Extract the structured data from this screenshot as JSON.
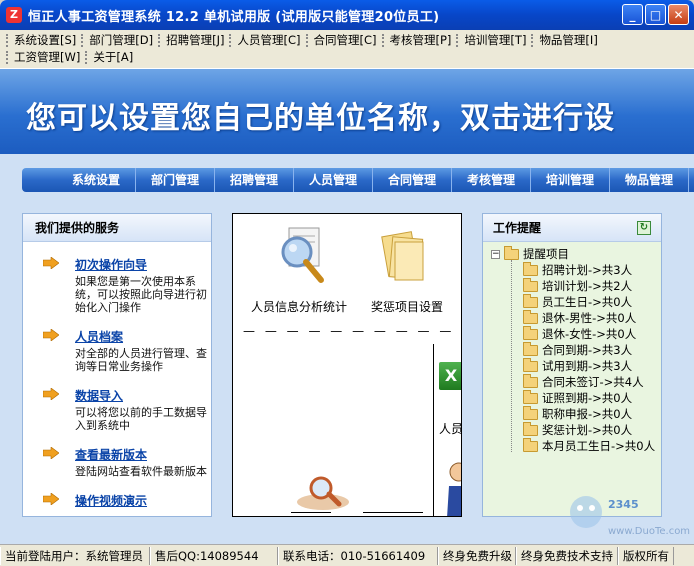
{
  "window": {
    "title": "恒正人事工资管理系统 12.2 单机试用版 (试用版只能管理20位员工)"
  },
  "menu": {
    "row1": [
      "系统设置[S]",
      "部门管理[D]",
      "招聘管理[J]",
      "人员管理[C]",
      "合同管理[C]",
      "考核管理[P]",
      "培训管理[T]",
      "物品管理[I]"
    ],
    "row2": [
      "工资管理[W]",
      "关于[A]"
    ]
  },
  "banner": {
    "text": "您可以设置您自己的单位名称，双击进行设"
  },
  "nav": [
    "系统设置",
    "部门管理",
    "招聘管理",
    "人员管理",
    "合同管理",
    "考核管理",
    "培训管理",
    "物品管理"
  ],
  "services": {
    "title": "我们提供的服务",
    "items": [
      {
        "title": "初次操作向导",
        "desc": "如果您是第一次使用本系统，可以按照此向导进行初始化入门操作"
      },
      {
        "title": "人员档案",
        "desc": "对全部的人员进行管理、查询等日常业务操作"
      },
      {
        "title": "数据导入",
        "desc": "可以将您以前的手工数据导入到系统中"
      },
      {
        "title": "查看最新版本",
        "desc": "登陆网站查看软件最新版本"
      },
      {
        "title": "操作视频演示",
        "desc": ""
      }
    ]
  },
  "center": {
    "item1": "人员信息分析统计",
    "item2": "奖惩项目设置",
    "item3_partial": "人员",
    "dashes": "— — — — — — — — — —"
  },
  "reminders": {
    "title": "工作提醒",
    "root": "提醒项目",
    "items": [
      "招聘计划->共3人",
      "培训计划->共2人",
      "员工生日->共0人",
      "退休-男性->共0人",
      "退休-女性->共0人",
      "合同到期->共3人",
      "试用到期->共3人",
      "合同未签订->共4人",
      "证照到期->共0人",
      "职称申报->共0人",
      "奖惩计划->共0人",
      "本月员工生日->共0人"
    ]
  },
  "status": {
    "user": "当前登陆用户：系统管理员",
    "qq": "售后QQ:14089544",
    "phone": "联系电话：010-51661409",
    "upgrade": "终身免费升级",
    "support": "终身免费技术支持",
    "copyright": "版权所有"
  },
  "colors": {
    "titlebar": "#0846c8",
    "banner": "#2a6fd0",
    "link": "#0b44a8",
    "reminder_bg": "#e9f5e0"
  }
}
